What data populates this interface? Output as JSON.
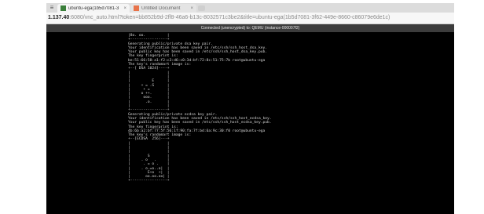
{
  "browser": {
    "tabs": [
      {
        "title": "ubuntu-ega(1b5d7081-3",
        "active": true
      },
      {
        "title": "Untitled Document",
        "active": false
      }
    ],
    "address": {
      "host": "1.137.40",
      "rest": ":6080/vnc_auto.html?token=bb852b9d-2ff8-46a6-b13c-8032571c3be2&title=ubuntu-ega(1b5d7081-3f62-449e-8660-c86079e6de1c)"
    }
  },
  "vnc": {
    "status": "Connected (unencrypted) to: QEMU (instance-000007f2)"
  },
  "console": {
    "lines": [
      "|8o. oo.          |",
      "+-----------------+",
      "Generating public/private dsa key pair.",
      "Your identification has been saved in /etc/ssh/ssh_host_dsa_key.",
      "Your public key has been saved in /etc/ssh/ssh_host_dsa_key.pub.",
      "The key fingerprint is:",
      "be:51:66:58:a1:f2:c3:d6:c0:3d:bf:72:8c:51:75:7b root@ubuntu-ega",
      "The key's randomart image is:",
      "+--[ DSA 1024]----+",
      "|                 |",
      "|                 |",
      "|          E      |",
      "|     + = .S      |",
      "|      + =        |",
      "|     o ++.       |",
      "|      ooo.       |",
      "|       .o.       |",
      "|                 |",
      "+-----------------+",
      "Generating public/private ecdsa key pair.",
      "Your identification has been saved in /etc/ssh/ssh_host_ecdsa_key.",
      "Your public key has been saved in /etc/ssh/ssh_host_ecdsa_key.pub.",
      "The key fingerprint is:",
      "4b:6b:a2:bf:77:5f:56:1f:90:fa:7f:bd:6a:9c:30:f0 root@ubuntu-ega",
      "The key's randomart image is:",
      "+--[ECDSA  256]---+",
      "|                 |",
      "|                 |",
      "|                 |",
      "|        S        |",
      "|     . o   .     |",
      "|      . = o .    |",
      "|     . o.=o..o|  |",
      "|        E+o  +|  |",
      "|       oo.oo.oo| |",
      "+-----------------+"
    ]
  }
}
